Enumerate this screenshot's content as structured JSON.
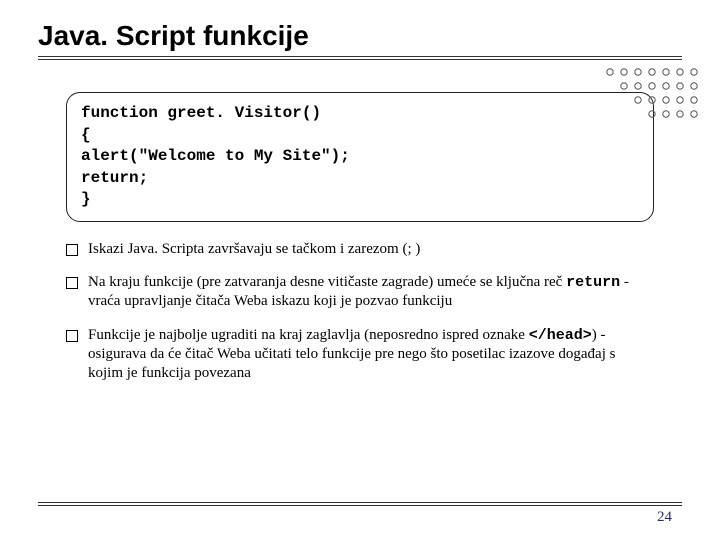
{
  "title": "Java. Script funkcije",
  "code": {
    "l1": "function greet. Visitor()",
    "l2": "{",
    "l3": "alert(\"Welcome to My Site\");",
    "l4": "return;",
    "l5": "}"
  },
  "bullets": {
    "b1": "Iskazi Java. Scripta završavaju se tačkom i zarezom (; )",
    "b2_pre": "Na kraju funkcije (pre zatvaranja desne vitičaste zagrade) umeće se ključna reč ",
    "b2_kw": "return",
    "b2_post": " - vraća upravljanje čitača Weba iskazu koji je pozvao funkciju",
    "b3_pre": "Funkcije je najbolje ugraditi na kraj zaglavlja (neposredno ispred oznake ",
    "b3_kw": "</head>",
    "b3_post": ") - osigurava da će čitač Weba učitati telo funkcije pre nego što posetilac izazove događaj s kojim je funkcija povezana"
  },
  "page": "24"
}
